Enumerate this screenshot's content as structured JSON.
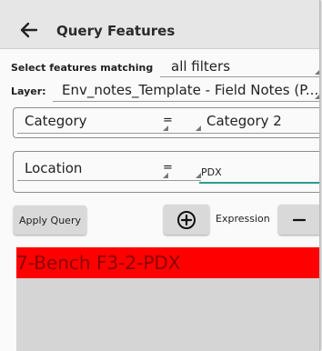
{
  "header": {
    "title": "Query Features",
    "back_icon": "arrow-left-icon"
  },
  "match": {
    "label": "Select features matching",
    "value": "all filters"
  },
  "layer": {
    "label": "Layer:",
    "value": "Env_notes_Template - Field Notes (P..."
  },
  "conditions": [
    {
      "field": "Category",
      "operator": "=",
      "value": "Category 2"
    },
    {
      "field": "Location",
      "operator": "=",
      "value": "PDX"
    }
  ],
  "actions": {
    "apply_label": "Apply Query",
    "add_icon": "circle-plus-icon",
    "expression_label": "Expression",
    "remove_icon": "minus-icon"
  },
  "results": {
    "items": [
      "7-Bench F3-2-PDX"
    ],
    "highlight_color": "#ff0000"
  }
}
